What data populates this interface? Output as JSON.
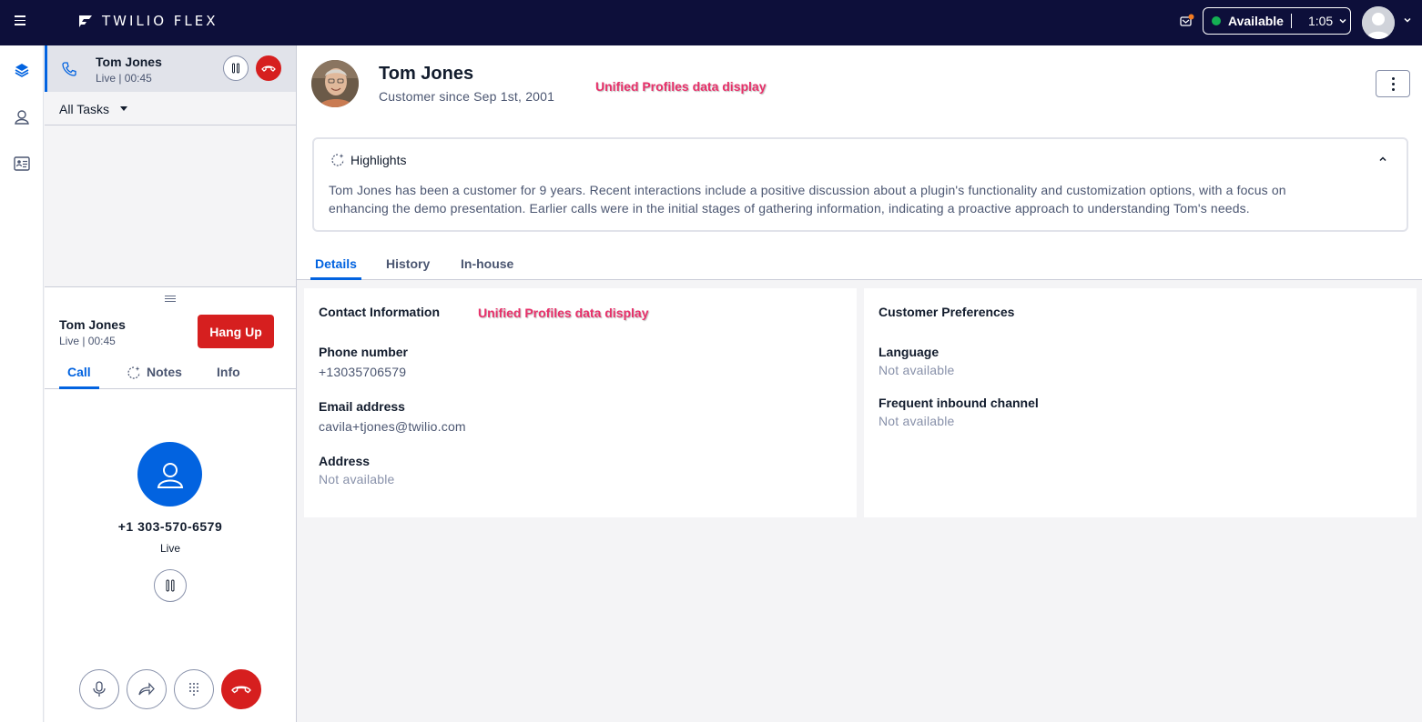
{
  "topbar": {
    "brand": "TWILIO FLEX",
    "status": "Available",
    "timer": "1:05",
    "icons": [
      "menu-icon",
      "notification-icon",
      "chevron-down-icon"
    ]
  },
  "rail": {
    "icons": [
      "layers-icon",
      "contacts-icon",
      "profile-card-icon"
    ]
  },
  "tasklist": {
    "task": {
      "name": "Tom Jones",
      "status": "Live | 00:45"
    },
    "filter": "All Tasks"
  },
  "callpanel": {
    "name": "Tom Jones",
    "status": "Live | 00:45",
    "hangup_label": "Hang Up",
    "tabs": [
      "Call",
      "Notes",
      "Info"
    ],
    "number": "+1 303-570-6579",
    "live_label": "Live"
  },
  "profile": {
    "name": "Tom Jones",
    "since": "Customer since Sep 1st, 2001",
    "annotation": "Unified Profiles data display"
  },
  "highlights": {
    "title": "Highlights",
    "text": "Tom Jones has been a customer for 9 years. Recent interactions include a positive discussion about a plugin's functionality and customization options, with a focus on enhancing the demo presentation. Earlier calls were in the initial stages of gathering information, indicating a proactive approach to understanding Tom's needs."
  },
  "tabs": [
    "Details",
    "History",
    "In-house"
  ],
  "contact": {
    "title": "Contact Information",
    "annotation": "Unified Profiles data display",
    "phone_label": "Phone number",
    "phone_value": "+13035706579",
    "email_label": "Email address",
    "email_value": "cavila+tjones@twilio.com",
    "address_label": "Address",
    "address_value": "Not available"
  },
  "preferences": {
    "title": "Customer Preferences",
    "language_label": "Language",
    "language_value": "Not available",
    "channel_label": "Frequent inbound channel",
    "channel_value": "Not available"
  },
  "colors": {
    "topbar": "#0d0f3a",
    "accent": "#0263e0",
    "danger": "#d61f1f",
    "available": "#14b053",
    "annotation": "#e8306a"
  }
}
